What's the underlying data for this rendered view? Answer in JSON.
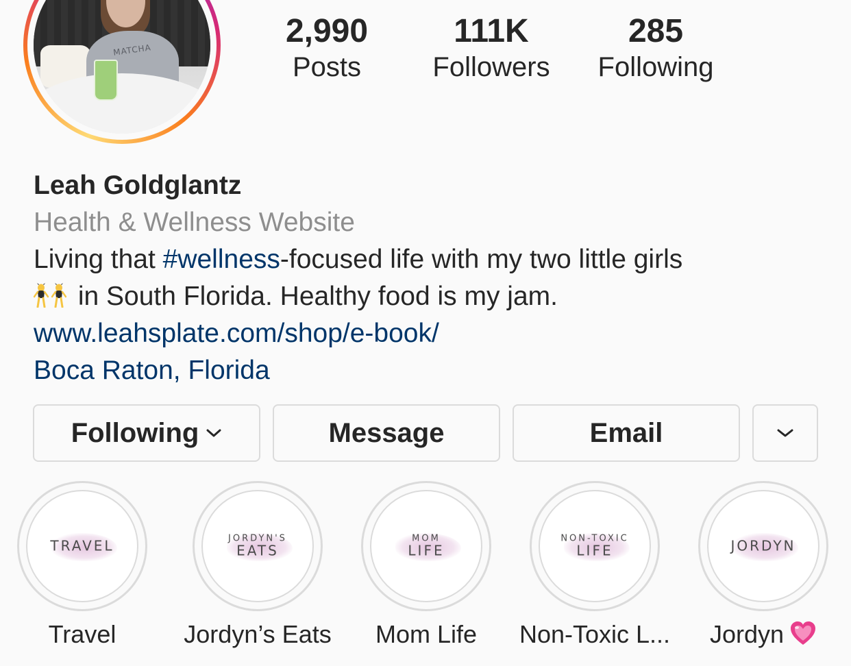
{
  "profile": {
    "name": "Leah Goldglantz",
    "category": "Health & Wellness Website",
    "bio_line1_pre": "Living that ",
    "bio_hashtag": "#wellness",
    "bio_line1_post": "-focused life with my two little girls",
    "bio_line2": " in South Florida. Healthy food is my jam.",
    "bio_emoji": "dancers-emoji",
    "website": "www.leahsplate.com/shop/e-book/",
    "location": "Boca Raton, Florida",
    "avatar_shirt_text": "MATCHA"
  },
  "stats": [
    {
      "value": "2,990",
      "label": "Posts"
    },
    {
      "value": "111K",
      "label": "Followers"
    },
    {
      "value": "285",
      "label": "Following"
    }
  ],
  "buttons": {
    "following": "Following",
    "message": "Message",
    "email": "Email",
    "more_icon": "chevron-down-icon"
  },
  "highlights": [
    {
      "cover_small": "",
      "cover_big": "TRAVEL",
      "label": "Travel"
    },
    {
      "cover_small": "JORDYN'S",
      "cover_big": "EATS",
      "label": "Jordyn’s Eats"
    },
    {
      "cover_small": "MOM",
      "cover_big": "LIFE",
      "label": "Mom Life"
    },
    {
      "cover_small": "NON-TOXIC",
      "cover_big": "LIFE",
      "label": "Non-Toxic L..."
    },
    {
      "cover_small": "",
      "cover_big": "JORDYN",
      "label": "Jordyn",
      "emoji": "pink-heart-emoji"
    }
  ],
  "colors": {
    "link": "#003569",
    "muted": "#8e8e8e",
    "border": "#dbdbdb",
    "background": "#fafafa",
    "text": "#262626"
  }
}
